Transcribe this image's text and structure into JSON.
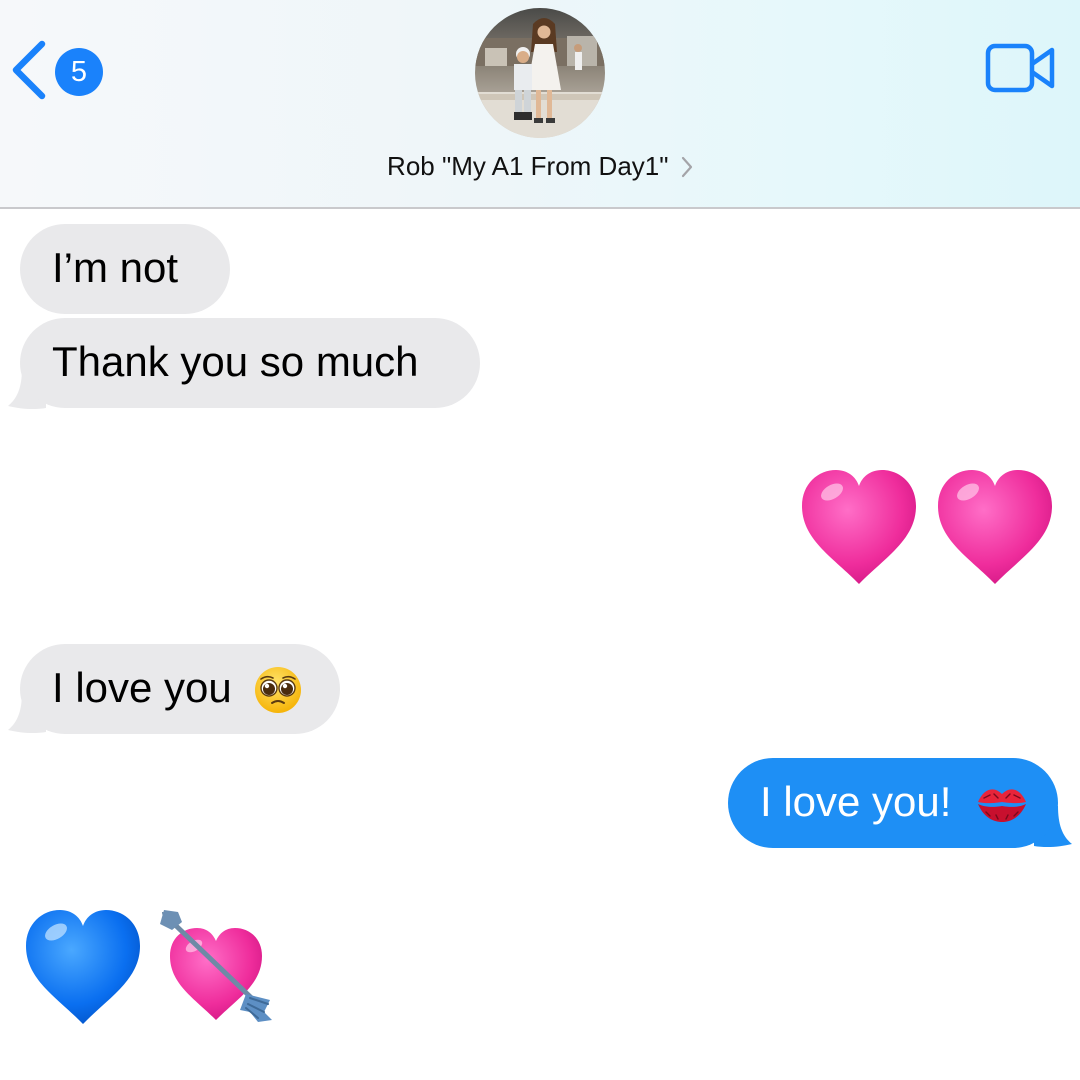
{
  "header": {
    "back_badge_count": "5",
    "contact_name": "Rob \"My A1 From Day1\""
  },
  "icons": {
    "back": "chevron-left-icon",
    "video": "video-camera-icon",
    "contact_chevron": "chevron-right-icon"
  },
  "colors": {
    "accent": "#1a82fb",
    "incoming_bubble": "#e9e9eb",
    "outgoing_bubble": "#1e8ff5",
    "pink_heart": "#f0229a",
    "blue_heart": "#0a6ff0"
  },
  "messages": [
    {
      "direction": "incoming",
      "text": "I’m not"
    },
    {
      "direction": "incoming",
      "text": "Thank you so much"
    },
    {
      "direction": "outgoing",
      "emoji": [
        "pink-heart",
        "pink-heart"
      ]
    },
    {
      "direction": "incoming",
      "text": "I love you",
      "emoji": "pleading-face"
    },
    {
      "direction": "outgoing",
      "text": "I love you!",
      "emoji": "kiss-mark"
    },
    {
      "direction": "incoming",
      "emoji": [
        "blue-heart",
        "heart-with-arrow"
      ]
    }
  ]
}
